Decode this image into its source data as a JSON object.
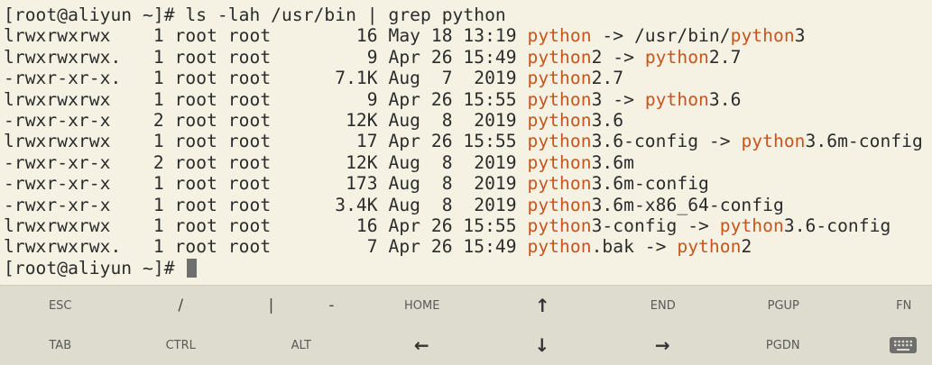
{
  "terminal": {
    "prompt_host": "[root@aliyun ~]# ",
    "command": "ls -lah /usr/bin | grep python",
    "lines": [
      {
        "pre": "lrwxrwxrwx    1 root root        16 May 18 13:19 ",
        "parts": [
          [
            "python",
            "hl"
          ],
          [
            " -> /usr/bin/",
            ""
          ],
          [
            "python",
            "hl"
          ],
          [
            "3",
            ""
          ]
        ]
      },
      {
        "pre": "lrwxrwxrwx.   1 root root         9 Apr 26 15:49 ",
        "parts": [
          [
            "python",
            "hl"
          ],
          [
            "2 -> ",
            ""
          ],
          [
            "python",
            "hl"
          ],
          [
            "2.7",
            ""
          ]
        ]
      },
      {
        "pre": "-rwxr-xr-x.   1 root root      7.1K Aug  7  2019 ",
        "parts": [
          [
            "python",
            "hl"
          ],
          [
            "2.7",
            ""
          ]
        ]
      },
      {
        "pre": "lrwxrwxrwx    1 root root         9 Apr 26 15:55 ",
        "parts": [
          [
            "python",
            "hl"
          ],
          [
            "3 -> ",
            ""
          ],
          [
            "python",
            "hl"
          ],
          [
            "3.6",
            ""
          ]
        ]
      },
      {
        "pre": "-rwxr-xr-x    2 root root       12K Aug  8  2019 ",
        "parts": [
          [
            "python",
            "hl"
          ],
          [
            "3.6",
            ""
          ]
        ]
      },
      {
        "pre": "lrwxrwxrwx    1 root root        17 Apr 26 15:55 ",
        "parts": [
          [
            "python",
            "hl"
          ],
          [
            "3.6-config -> ",
            ""
          ],
          [
            "python",
            "hl"
          ],
          [
            "3.6m-config",
            ""
          ]
        ]
      },
      {
        "pre": "-rwxr-xr-x    2 root root       12K Aug  8  2019 ",
        "parts": [
          [
            "python",
            "hl"
          ],
          [
            "3.6m",
            ""
          ]
        ]
      },
      {
        "pre": "-rwxr-xr-x    1 root root       173 Aug  8  2019 ",
        "parts": [
          [
            "python",
            "hl"
          ],
          [
            "3.6m-config",
            ""
          ]
        ]
      },
      {
        "pre": "-rwxr-xr-x    1 root root      3.4K Aug  8  2019 ",
        "parts": [
          [
            "python",
            "hl"
          ],
          [
            "3.6m-x86_64-config",
            ""
          ]
        ]
      },
      {
        "pre": "lrwxrwxrwx    1 root root        16 Apr 26 15:55 ",
        "parts": [
          [
            "python",
            "hl"
          ],
          [
            "3-config -> ",
            ""
          ],
          [
            "python",
            "hl"
          ],
          [
            "3.6-config",
            ""
          ]
        ]
      },
      {
        "pre": "lrwxrwxrwx.   1 root root         7 Apr 26 15:49 ",
        "parts": [
          [
            "python",
            "hl"
          ],
          [
            ".bak -> ",
            ""
          ],
          [
            "python",
            "hl"
          ],
          [
            "2",
            ""
          ]
        ]
      }
    ],
    "final_prompt": "[root@aliyun ~]# "
  },
  "keyboard": {
    "row1": [
      {
        "label": "ESC",
        "name": "esc-key",
        "kind": "text"
      },
      {
        "label": "/",
        "name": "slash-key",
        "kind": "sym"
      },
      {
        "label": "|",
        "name": "pipe-key",
        "kind": "sym",
        "narrow": true
      },
      {
        "label": "-",
        "name": "dash-key",
        "kind": "sym",
        "narrow": true
      },
      {
        "label": "HOME",
        "name": "home-key",
        "kind": "text"
      },
      {
        "label": "↑",
        "name": "up-arrow-key",
        "kind": "arrow"
      },
      {
        "label": "END",
        "name": "end-key",
        "kind": "text"
      },
      {
        "label": "PGUP",
        "name": "pgup-key",
        "kind": "text"
      },
      {
        "label": "FN",
        "name": "fn-key",
        "kind": "text"
      }
    ],
    "row2": [
      {
        "label": "TAB",
        "name": "tab-key",
        "kind": "text"
      },
      {
        "label": "CTRL",
        "name": "ctrl-key",
        "kind": "text"
      },
      {
        "label": "ALT",
        "name": "alt-key",
        "kind": "text"
      },
      {
        "label": "←",
        "name": "left-arrow-key",
        "kind": "arrow"
      },
      {
        "label": "↓",
        "name": "down-arrow-key",
        "kind": "arrow"
      },
      {
        "label": "→",
        "name": "right-arrow-key",
        "kind": "arrow"
      },
      {
        "label": "PGDN",
        "name": "pgdn-key",
        "kind": "text"
      },
      {
        "label": "",
        "name": "keyboard-toggle-button",
        "kind": "icon",
        "icon": "keyboard-icon"
      }
    ]
  }
}
